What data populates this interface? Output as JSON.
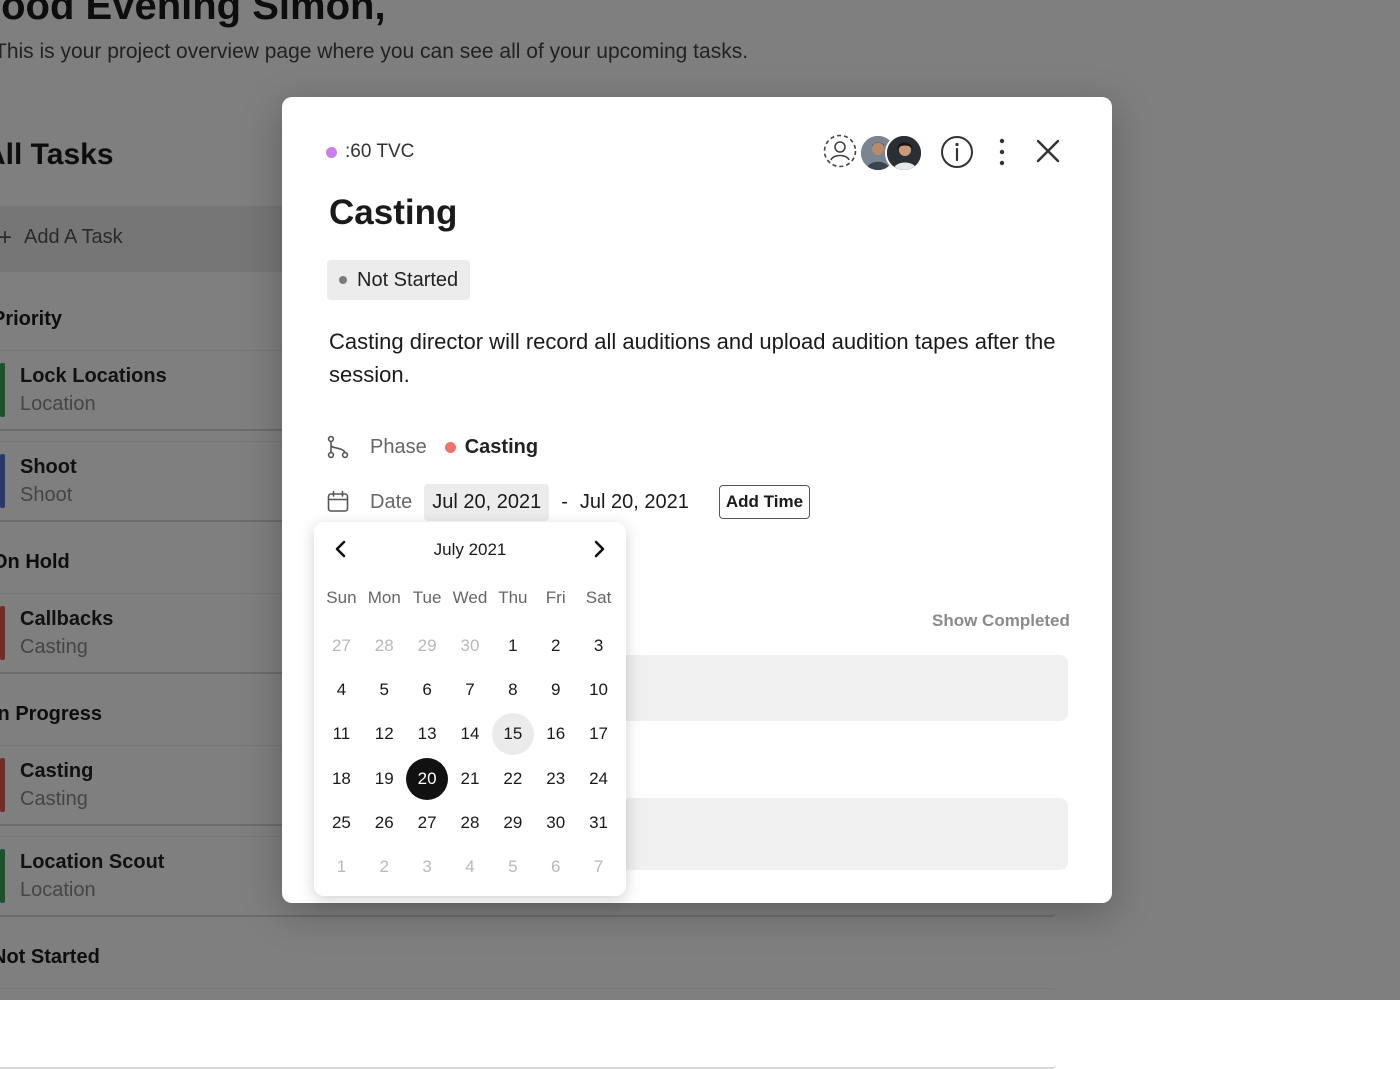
{
  "background": {
    "greeting": "Good Evening Simon,",
    "subtitle": "This is your project overview page where you can see all of your upcoming tasks.",
    "section_heading": "All Tasks",
    "add_task_label": "Add A Task",
    "sections": {
      "priority": "Priority",
      "on_hold": "On Hold",
      "in_progress": "In Progress",
      "not_started": "Not Started"
    },
    "tasks": [
      {
        "title": "Lock Locations",
        "subtitle": "Location",
        "color": "#3aa55d"
      },
      {
        "title": "Shoot",
        "subtitle": "Shoot",
        "color": "#5b6fd6"
      },
      {
        "title": "Callbacks",
        "subtitle": "Casting",
        "color": "#e05a50"
      },
      {
        "title": "Casting",
        "subtitle": "Casting",
        "color": "#e05a50"
      },
      {
        "title": "Location Scout",
        "subtitle": "Location",
        "color": "#3aa55d"
      }
    ]
  },
  "modal": {
    "project": {
      "name": ":60 TVC",
      "color": "#c97ef0"
    },
    "title": "Casting",
    "status": "Not Started",
    "description": "Casting director will record all auditions and upload audition tapes after the session.",
    "phase": {
      "label": "Phase",
      "value": "Casting",
      "color": "#f0736a"
    },
    "date": {
      "label": "Date",
      "start": "Jul 20, 2021",
      "separator": "-",
      "end": "Jul 20, 2021",
      "add_time_label": "Add Time"
    },
    "show_completed_label": "Show Completed",
    "icons": {
      "assign": "assign-user-icon",
      "info": "info-icon",
      "more": "more-vertical-icon",
      "close": "close-icon",
      "phase": "phase-branch-icon",
      "date": "calendar-icon"
    }
  },
  "datepicker": {
    "month_label": "July 2021",
    "weekdays": [
      "Sun",
      "Mon",
      "Tue",
      "Wed",
      "Thu",
      "Fri",
      "Sat"
    ],
    "days": [
      {
        "d": "27",
        "muted": true
      },
      {
        "d": "28",
        "muted": true
      },
      {
        "d": "29",
        "muted": true
      },
      {
        "d": "30",
        "muted": true
      },
      {
        "d": "1"
      },
      {
        "d": "2"
      },
      {
        "d": "3"
      },
      {
        "d": "4"
      },
      {
        "d": "5"
      },
      {
        "d": "6"
      },
      {
        "d": "7"
      },
      {
        "d": "8"
      },
      {
        "d": "9"
      },
      {
        "d": "10"
      },
      {
        "d": "11"
      },
      {
        "d": "12"
      },
      {
        "d": "13"
      },
      {
        "d": "14"
      },
      {
        "d": "15",
        "today": true
      },
      {
        "d": "16"
      },
      {
        "d": "17"
      },
      {
        "d": "18"
      },
      {
        "d": "19"
      },
      {
        "d": "20",
        "selected": true
      },
      {
        "d": "21"
      },
      {
        "d": "22"
      },
      {
        "d": "23"
      },
      {
        "d": "24"
      },
      {
        "d": "25"
      },
      {
        "d": "26"
      },
      {
        "d": "27"
      },
      {
        "d": "28"
      },
      {
        "d": "29"
      },
      {
        "d": "30"
      },
      {
        "d": "31"
      },
      {
        "d": "1",
        "muted": true
      },
      {
        "d": "2",
        "muted": true
      },
      {
        "d": "3",
        "muted": true
      },
      {
        "d": "4",
        "muted": true
      },
      {
        "d": "5",
        "muted": true
      },
      {
        "d": "6",
        "muted": true
      },
      {
        "d": "7",
        "muted": true
      }
    ]
  }
}
